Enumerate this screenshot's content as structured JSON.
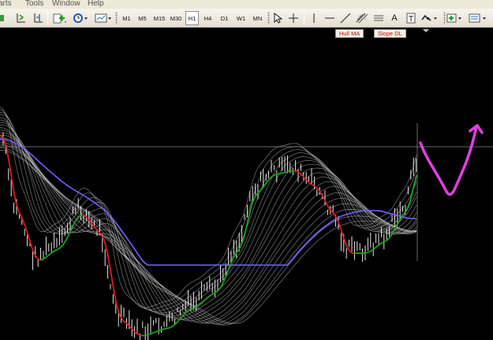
{
  "menu": {
    "items": [
      "arts",
      "Tools",
      "Window",
      "Help"
    ]
  },
  "toolbar": {
    "timeframes": [
      "M1",
      "M5",
      "M15",
      "M30",
      "H1",
      "H4",
      "D1",
      "W1",
      "MN"
    ],
    "active_timeframe": "H1",
    "icons": [
      "chart-left-icon",
      "auto-scroll-icon",
      "chart-shift-icon",
      "new-order-icon",
      "clock-icon",
      "templates-icon",
      "cursor-icon",
      "crosshair-icon",
      "vertical-line-icon",
      "horizontal-line-icon",
      "trendline-icon",
      "fibonacci-icon",
      "text-icon",
      "text-label-icon",
      "arrows-icon",
      "add-indicator-icon",
      "periodicity-icon"
    ],
    "text_tool_label": "A",
    "label_tool_label": "T"
  },
  "chart": {
    "indicator_buttons": [
      "Hull MA",
      "Slope DL"
    ],
    "colors": {
      "background": "#000000",
      "candles": "#ffffff",
      "ribbon": "#d8d8d8",
      "slow_ma": "#6f63ff",
      "hull_down": "#d81e1e",
      "hull_up": "#1fa31f",
      "annotation": "#e040e0",
      "crosshair": "#8a8a8a"
    },
    "annotation": "hand-drawn V with upward arrow"
  }
}
